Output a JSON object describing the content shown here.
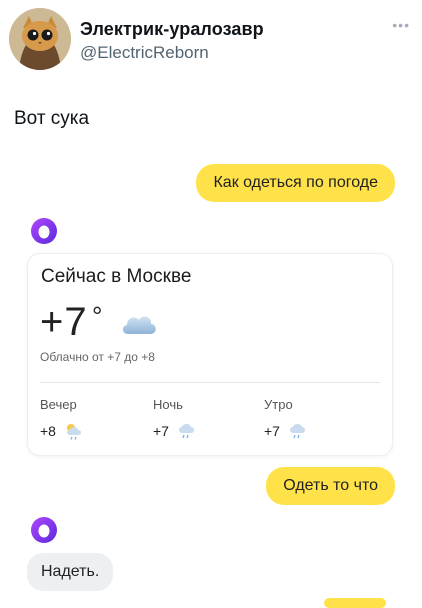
{
  "tweet": {
    "author_name": "Электрик-уралозавр",
    "author_handle": "@ElectricReborn",
    "text": "Вот сука",
    "avatar_icon": "cat-avatar-icon",
    "more_icon": "more-dots-icon"
  },
  "chat": {
    "user_message_1": "Как одеться по погоде",
    "user_message_2": "Одеть то что",
    "alice_reply": "Надеть.",
    "assistant_icon": "alice-ring-icon",
    "colors": {
      "user_bubble": "#ffe249",
      "assistant_bubble": "#edf0f2",
      "alice_ring": "#8a2be2"
    }
  },
  "weather": {
    "title": "Сейчас в Москве",
    "temp": "+7",
    "degree": "°",
    "description": "Облачно от +7 до +8",
    "icon": "cloud-icon",
    "periods": [
      {
        "label": "Вечер",
        "temp": "+8",
        "icon": "partly-cloudy-rain-icon"
      },
      {
        "label": "Ночь",
        "temp": "+7",
        "icon": "cloud-rain-icon"
      },
      {
        "label": "Утро",
        "temp": "+7",
        "icon": "cloud-rain-icon"
      }
    ]
  }
}
